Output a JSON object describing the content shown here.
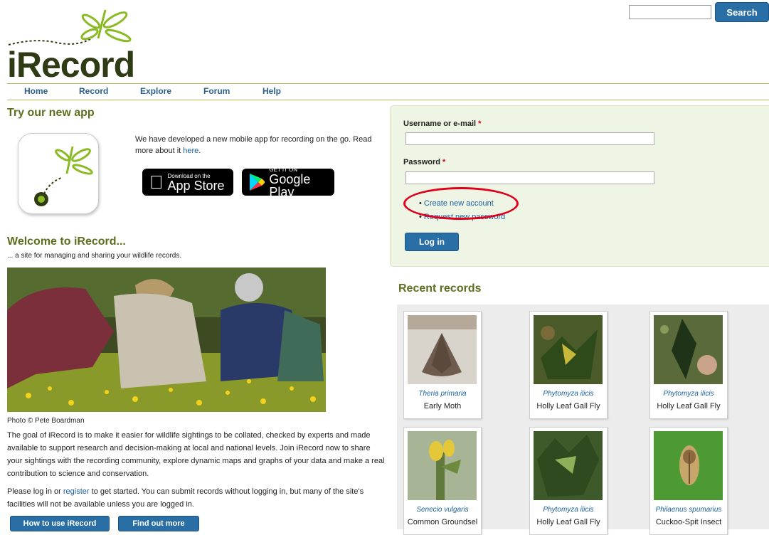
{
  "search": {
    "placeholder": "",
    "button_label": "Search"
  },
  "logo": {
    "text": "iRecord"
  },
  "nav": {
    "items": [
      "Home",
      "Record",
      "Explore",
      "Forum",
      "Help"
    ]
  },
  "app_section": {
    "heading": "Try our new app",
    "text_before_link": "We have developed a new mobile app for recording on the go. Read more about it ",
    "link": "here",
    "text_after_link": ".",
    "app_store": {
      "line1": "Download on the",
      "line2": "App Store"
    },
    "google_play": {
      "line1": "GET IT ON",
      "line2": "Google Play"
    }
  },
  "welcome": {
    "heading": "Welcome to iRecord...",
    "subtitle": "... a site for managing and sharing your wildlife records.",
    "photo_credit": "Photo © Pete Boardman",
    "paragraph1": "The goal of iRecord is to make it easier for wildlife sightings to be collated, checked by experts and made available to support research and decision-making at local and national levels.  Join iRecord now to share your sightings with the recording community, explore dynamic maps and graphs of your data and make a real contribution to science and conservation.",
    "p2_before": "Please log in or ",
    "p2_link": "register",
    "p2_after": " to get started.  You can submit records without logging in, but many of the site's facilities will not be available unless you are logged in.",
    "how_to_button": "How to use iRecord",
    "find_out_button": "Find out more"
  },
  "login": {
    "username_label": "Username or e-mail",
    "password_label": "Password",
    "required_mark": "*",
    "username_value": "",
    "password_value": "",
    "links": [
      "Create new account",
      "Request new password"
    ],
    "submit_label": "Log in",
    "highlight_color": "#e0001b"
  },
  "recent_records": {
    "heading": "Recent records",
    "cards": [
      {
        "scientific": "Theria primaria",
        "common": "Early Moth"
      },
      {
        "scientific": "Phytomyza ilicis",
        "common": "Holly Leaf Gall Fly"
      },
      {
        "scientific": "Phytomyza ilicis",
        "common": "Holly Leaf Gall Fly"
      },
      {
        "scientific": "Senecio vulgaris",
        "common": "Common Groundsel"
      },
      {
        "scientific": "Phytomyza ilicis",
        "common": "Holly Leaf Gall Fly"
      },
      {
        "scientific": "Philaenus spumarius",
        "common": "Cuckoo-Spit Insect"
      }
    ]
  },
  "colors": {
    "accent_blue": "#2a6ea6",
    "heading_green": "#5b6f1f",
    "login_bg": "#eef5e4"
  }
}
